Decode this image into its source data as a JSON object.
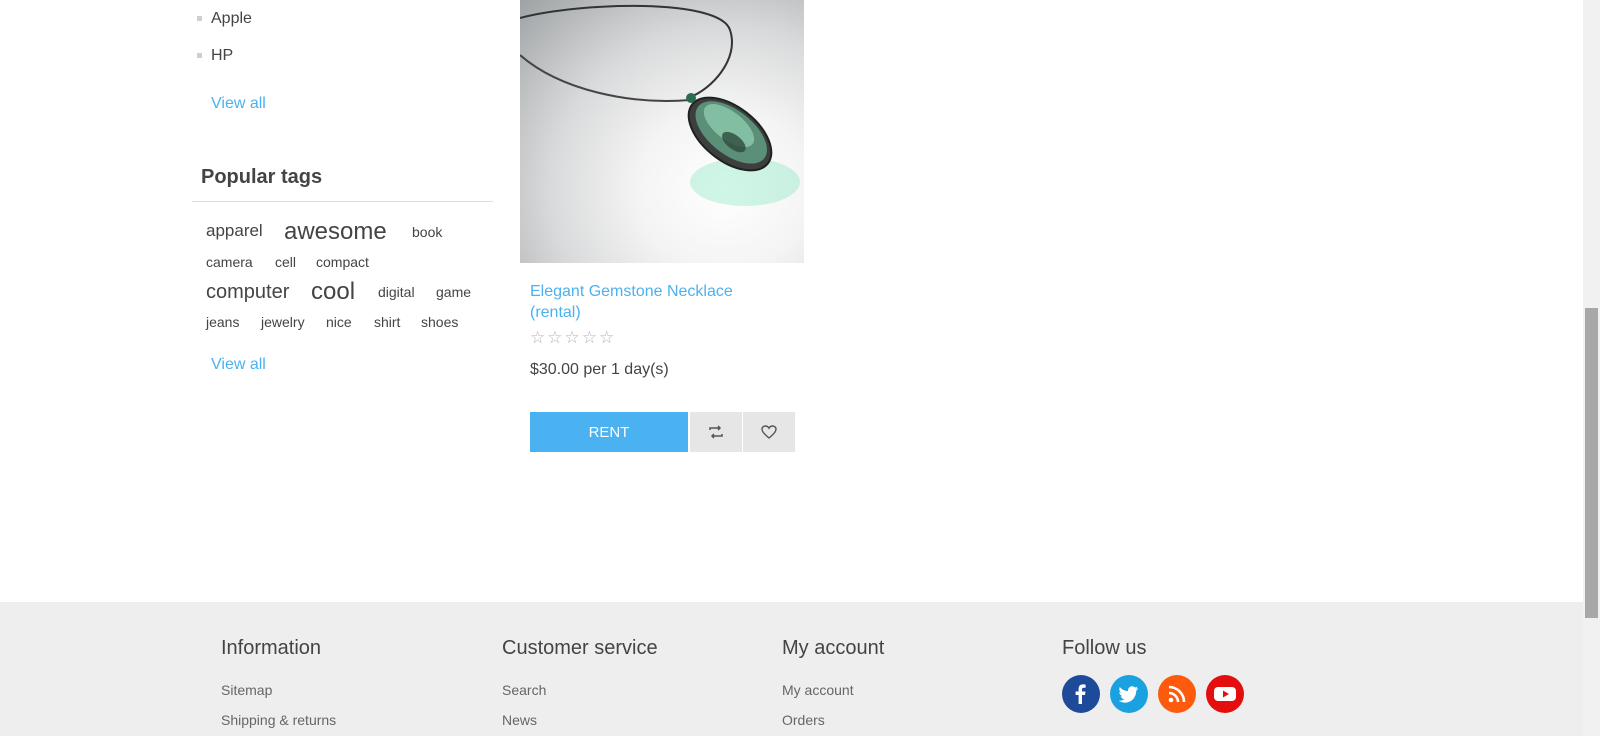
{
  "sidebar": {
    "manufacturers": [
      "Apple",
      "HP"
    ],
    "manufacturers_view_all": "View all",
    "tags_title": "Popular tags",
    "tags": [
      "apparel",
      "awesome",
      "book",
      "camera",
      "cell",
      "compact",
      "computer",
      "cool",
      "digital",
      "game",
      "jeans",
      "jewelry",
      "nice",
      "shirt",
      "shoes"
    ],
    "tags_view_all": "View all"
  },
  "product": {
    "title": "Elegant Gemstone Necklace (rental)",
    "rating": "☆☆☆☆☆",
    "price": "$30.00 per 1 day(s)",
    "rent_label": "RENT",
    "compare_icon": "compare-icon",
    "wishlist_icon": "heart-icon"
  },
  "footer": {
    "information": {
      "title": "Information",
      "links": [
        "Sitemap",
        "Shipping & returns"
      ]
    },
    "customer_service": {
      "title": "Customer service",
      "links": [
        "Search",
        "News"
      ]
    },
    "my_account": {
      "title": "My account",
      "links": [
        "My account",
        "Orders"
      ]
    },
    "follow_us": {
      "title": "Follow us",
      "networks": [
        "facebook-icon",
        "twitter-icon",
        "rss-icon",
        "youtube-icon"
      ]
    }
  },
  "colors": {
    "accent": "#4ab2f1",
    "facebook": "#1e4a9a",
    "twitter": "#1ba1e0",
    "rss": "#fe5a0e",
    "youtube": "#e40e0e",
    "footer_bg": "#eeeeee"
  }
}
